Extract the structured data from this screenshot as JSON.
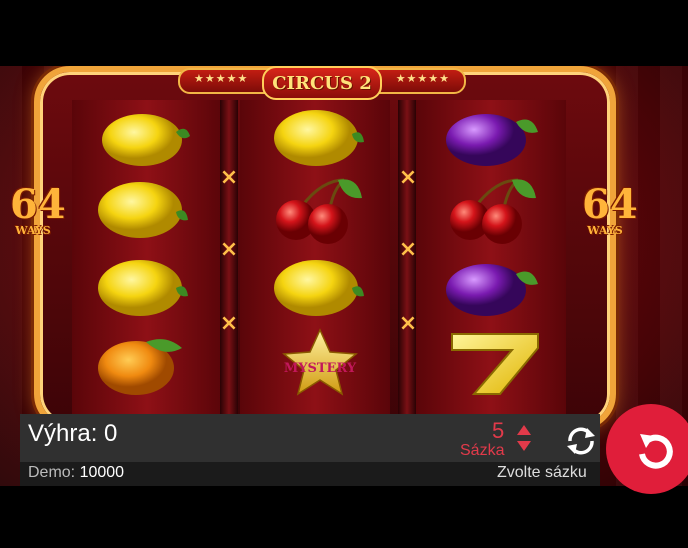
{
  "game": {
    "title": "CIRCUS 2",
    "title_stars_left": "★★★★★",
    "title_stars_right": "★★★★★",
    "ways_number": "64",
    "ways_label": "WAYS",
    "multiplier_symbol": "×",
    "mystery_label": "MYSTERY",
    "reels": [
      [
        "lemon",
        "lemon",
        "lemon",
        "orange"
      ],
      [
        "lemon",
        "cherry",
        "lemon",
        "mystery-star"
      ],
      [
        "plum",
        "cherry",
        "plum",
        "seven"
      ]
    ]
  },
  "bottom_bar": {
    "win_label": "Výhra:",
    "win_value": "0",
    "bet_value": "5",
    "bet_label": "Sázka",
    "demo_label": "Demo:",
    "demo_value": "10000",
    "choose_bet": "Zvolte sázku",
    "autoplay_icon": "refresh-icon",
    "spin_icon": "spin-icon"
  },
  "colors": {
    "accent_red": "#e01e3a",
    "gold": "#f0a43a",
    "bar_bg": "#303030"
  }
}
